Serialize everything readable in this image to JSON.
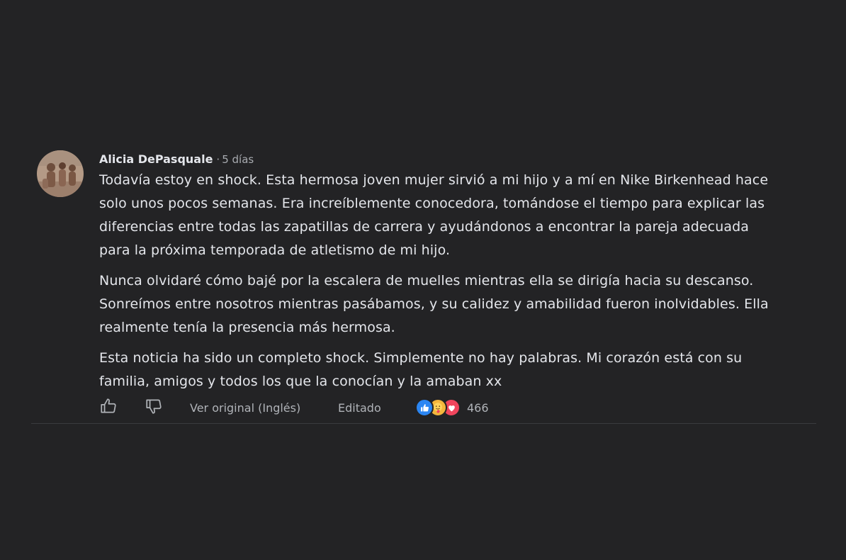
{
  "comment": {
    "author": "Alicia DePasquale",
    "separator": "·",
    "time": "5 días",
    "paragraphs": [
      "Todavía estoy en shock. Esta hermosa joven mujer sirvió a mi hijo y a mí en Nike Birkenhead hace solo unos pocos semanas. Era increíblemente conocedora, tomándose el tiempo para explicar las diferencias entre todas las zapatillas de carrera y ayudándonos a encontrar la pareja adecuada para la próxima temporada de atletismo de mi hijo.",
      "Nunca olvidaré cómo bajé por la escalera de muelles mientras ella se dirigía hacia su descanso. Sonreímos entre nosotros mientras pasábamos, y su calidez y amabilidad fueron inolvidables. Ella realmente tenía la presencia más hermosa.",
      "Esta noticia ha sido un completo shock. Simplemente no hay palabras. Mi corazón está con su familia, amigos y todos los que la conocían y la amaban xx"
    ]
  },
  "actions": {
    "like_icon": "thumbs-up-icon",
    "dislike_icon": "thumbs-down-icon",
    "view_original": "Ver original (Inglés)",
    "edited": "Editado",
    "reaction_icons": [
      "like-reaction-icon",
      "care-reaction-icon",
      "love-reaction-icon"
    ],
    "reaction_count": "466"
  },
  "colors": {
    "background": "#232325",
    "text": "#e4e6eb",
    "muted": "#b0b3b8",
    "like_blue": "#2b86f3",
    "care_yellow": "#f4b63c",
    "love_red": "#f0455d"
  }
}
